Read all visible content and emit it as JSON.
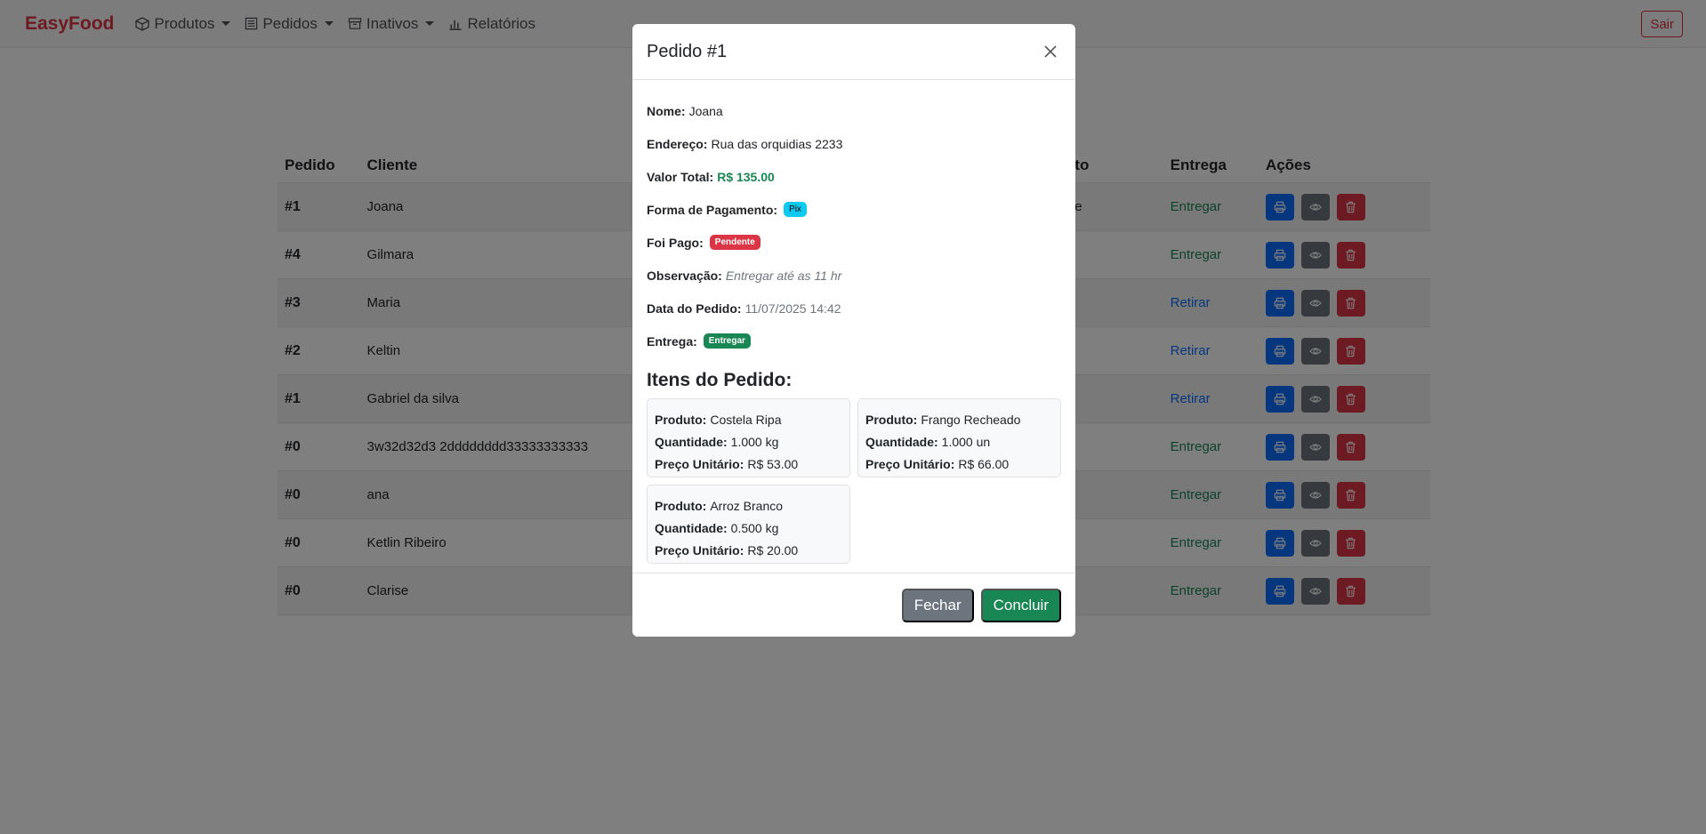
{
  "navbar": {
    "brand": "EasyFood",
    "items": [
      {
        "label": "Produtos",
        "icon": "box-icon",
        "dropdown": true
      },
      {
        "label": "Pedidos",
        "icon": "list-icon",
        "dropdown": true
      },
      {
        "label": "Inativos",
        "icon": "archive-icon",
        "dropdown": true
      },
      {
        "label": "Relatórios",
        "icon": "bar-chart-icon",
        "dropdown": false
      }
    ],
    "logout_label": "Sair"
  },
  "table": {
    "headers": {
      "pedido": "Pedido",
      "cliente": "Cliente",
      "pagamento_partial": "to",
      "entrega": "Entrega",
      "acoes": "Ações"
    },
    "rows": [
      {
        "pedido": "#1",
        "cliente": "Joana",
        "pagamento_partial": "e",
        "entrega": "Entregar",
        "entrega_type": "green"
      },
      {
        "pedido": "#4",
        "cliente": "Gilmara",
        "pagamento_partial": "",
        "entrega": "Entregar",
        "entrega_type": "green"
      },
      {
        "pedido": "#3",
        "cliente": "Maria",
        "pagamento_partial": "",
        "entrega": "Retirar",
        "entrega_type": "blue"
      },
      {
        "pedido": "#2",
        "cliente": "Keltin",
        "pagamento_partial": "",
        "entrega": "Retirar",
        "entrega_type": "blue"
      },
      {
        "pedido": "#1",
        "cliente": "Gabriel da silva",
        "pagamento_partial": "",
        "entrega": "Retirar",
        "entrega_type": "blue"
      },
      {
        "pedido": "#0",
        "cliente": "3w32d32d3 2dddddddd33333333333",
        "pagamento_partial": "",
        "entrega": "Entregar",
        "entrega_type": "green"
      },
      {
        "pedido": "#0",
        "cliente": "ana",
        "pagamento_partial": "",
        "entrega": "Entregar",
        "entrega_type": "green"
      },
      {
        "pedido": "#0",
        "cliente": "Ketlin Ribeiro",
        "pagamento_partial": "",
        "entrega": "Entregar",
        "entrega_type": "green"
      },
      {
        "pedido": "#0",
        "cliente": "Clarise",
        "pagamento_partial": "",
        "entrega": "Entregar",
        "entrega_type": "green"
      }
    ]
  },
  "modal": {
    "title": "Pedido #1",
    "nome_label": "Nome:",
    "nome": "Joana",
    "endereco_label": "Endereço:",
    "endereco": "Rua das orquidias 2233",
    "valor_label": "Valor Total:",
    "valor": "R$ 135.00",
    "forma_label": "Forma de Pagamento:",
    "forma": "Pix",
    "pago_label": "Foi Pago:",
    "pago": "Pendente",
    "obs_label": "Observação:",
    "obs": "Entregar até as 11 hr",
    "data_label": "Data do Pedido:",
    "data": "11/07/2025 14:42",
    "entrega_label": "Entrega:",
    "entrega": "Entregar",
    "items_title": "Itens do Pedido:",
    "item_labels": {
      "produto": "Produto:",
      "quantidade": "Quantidade:",
      "preco": "Preço Unitário:"
    },
    "items": [
      {
        "produto": "Costela Ripa",
        "quantidade": "1.000 kg",
        "preco": "R$ 53.00"
      },
      {
        "produto": "Frango Recheado",
        "quantidade": "1.000 un",
        "preco": "R$ 66.00"
      },
      {
        "produto": "Arroz Branco",
        "quantidade": "0.500 kg",
        "preco": "R$ 20.00"
      }
    ],
    "close_label": "Fechar",
    "confirm_label": "Concluir"
  },
  "colors": {
    "brand": "#dc3545",
    "primary": "#0d6efd",
    "success": "#198754",
    "danger": "#dc3545",
    "info": "#0dcaf0",
    "secondary": "#6c757d"
  }
}
